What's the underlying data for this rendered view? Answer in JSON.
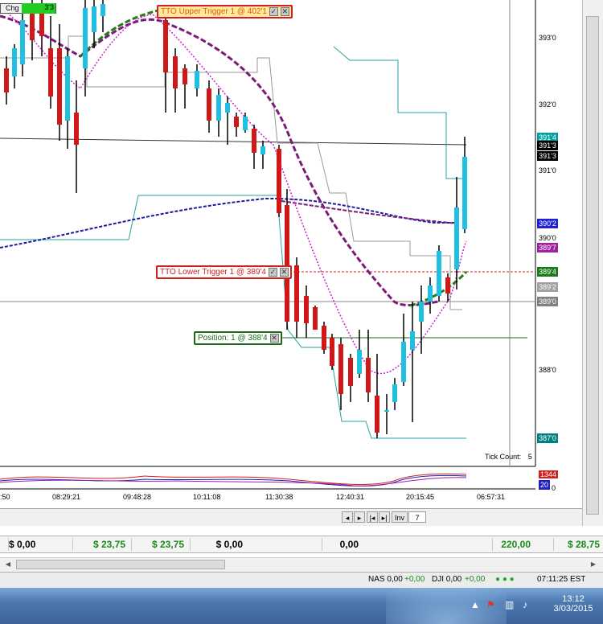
{
  "chart": {
    "top_left_label": "Chg",
    "top_left_value": "3'3",
    "tick_count_label": "Tick Count:",
    "tick_count_value": "5",
    "upper_trigger": "TTO Upper Trigger 1 @ 402'1",
    "lower_trigger": "TTO Lower Trigger 1 @ 389'4",
    "position_order": "Position: 1 @ 388'4",
    "order_button_glyphs": {
      "modify": "✓",
      "cancel": "✕"
    },
    "price_axis": [
      "393'0",
      "392'0",
      "391'0",
      "390'0",
      "388'0"
    ],
    "price_tags": [
      {
        "text": "391'4",
        "bg": "#00a0a0",
        "fg": "#ffffff"
      },
      {
        "text": "391'3",
        "bg": "#000000",
        "fg": "#ffffff"
      },
      {
        "text": "391'3",
        "bg": "#000000",
        "fg": "#ffffff"
      },
      {
        "text": "390'2",
        "bg": "#2020d0",
        "fg": "#ffffff"
      },
      {
        "text": "389'7",
        "bg": "#a020a0",
        "fg": "#ffffff"
      },
      {
        "text": "389'4",
        "bg": "#1a7a1a",
        "fg": "#ffffff"
      },
      {
        "text": "389'2",
        "bg": "#a0a0a0",
        "fg": "#ffffff"
      },
      {
        "text": "389'0",
        "bg": "#808080",
        "fg": "#ffffff"
      },
      {
        "text": "387'0",
        "bg": "#008080",
        "fg": "#ffffff"
      }
    ],
    "time_axis": [
      ":50",
      "08:29:21",
      "09:48:28",
      "10:11:08",
      "11:30:38",
      "12:40:31",
      "20:15:45",
      "06:57:31"
    ],
    "indicator_tags": [
      {
        "text": "1344",
        "bg": "#d02020"
      },
      {
        "text": "20",
        "bg": "#2020c0"
      }
    ],
    "indicator_axis_value": "0",
    "colors": {
      "up_candle": "#20c0e0",
      "down_candle": "#d01818",
      "ma_purple": "#7a1a7a",
      "ma_green": "#2a7a1a",
      "ma_blue": "#1a1aa0",
      "channel_teal": "#2aa0a0",
      "trigger_red": "#d02020"
    }
  },
  "tabs": {
    "items": [
      "Inv",
      "7"
    ]
  },
  "values_bar": {
    "cells": [
      {
        "text": "$ 0,00",
        "style": "neg"
      },
      {
        "text": "$ 23,75",
        "style": "pos"
      },
      {
        "text": "$ 23,75",
        "style": "pos"
      },
      {
        "text": "$ 0,00",
        "style": "neg"
      },
      {
        "text": "0,00",
        "style": "neg"
      },
      {
        "text": "220,00",
        "style": "pos"
      },
      {
        "text": "$ 28,75",
        "style": "pos"
      }
    ]
  },
  "status_bar": {
    "nas_label": "NAS 0,00",
    "nas_change": "+0,00",
    "dji_label": "DJI 0,00",
    "dji_change": "+0,00",
    "time": "07:11:25 EST"
  },
  "taskbar": {
    "clock_time": "13:12",
    "clock_date": "3/03/2015"
  }
}
